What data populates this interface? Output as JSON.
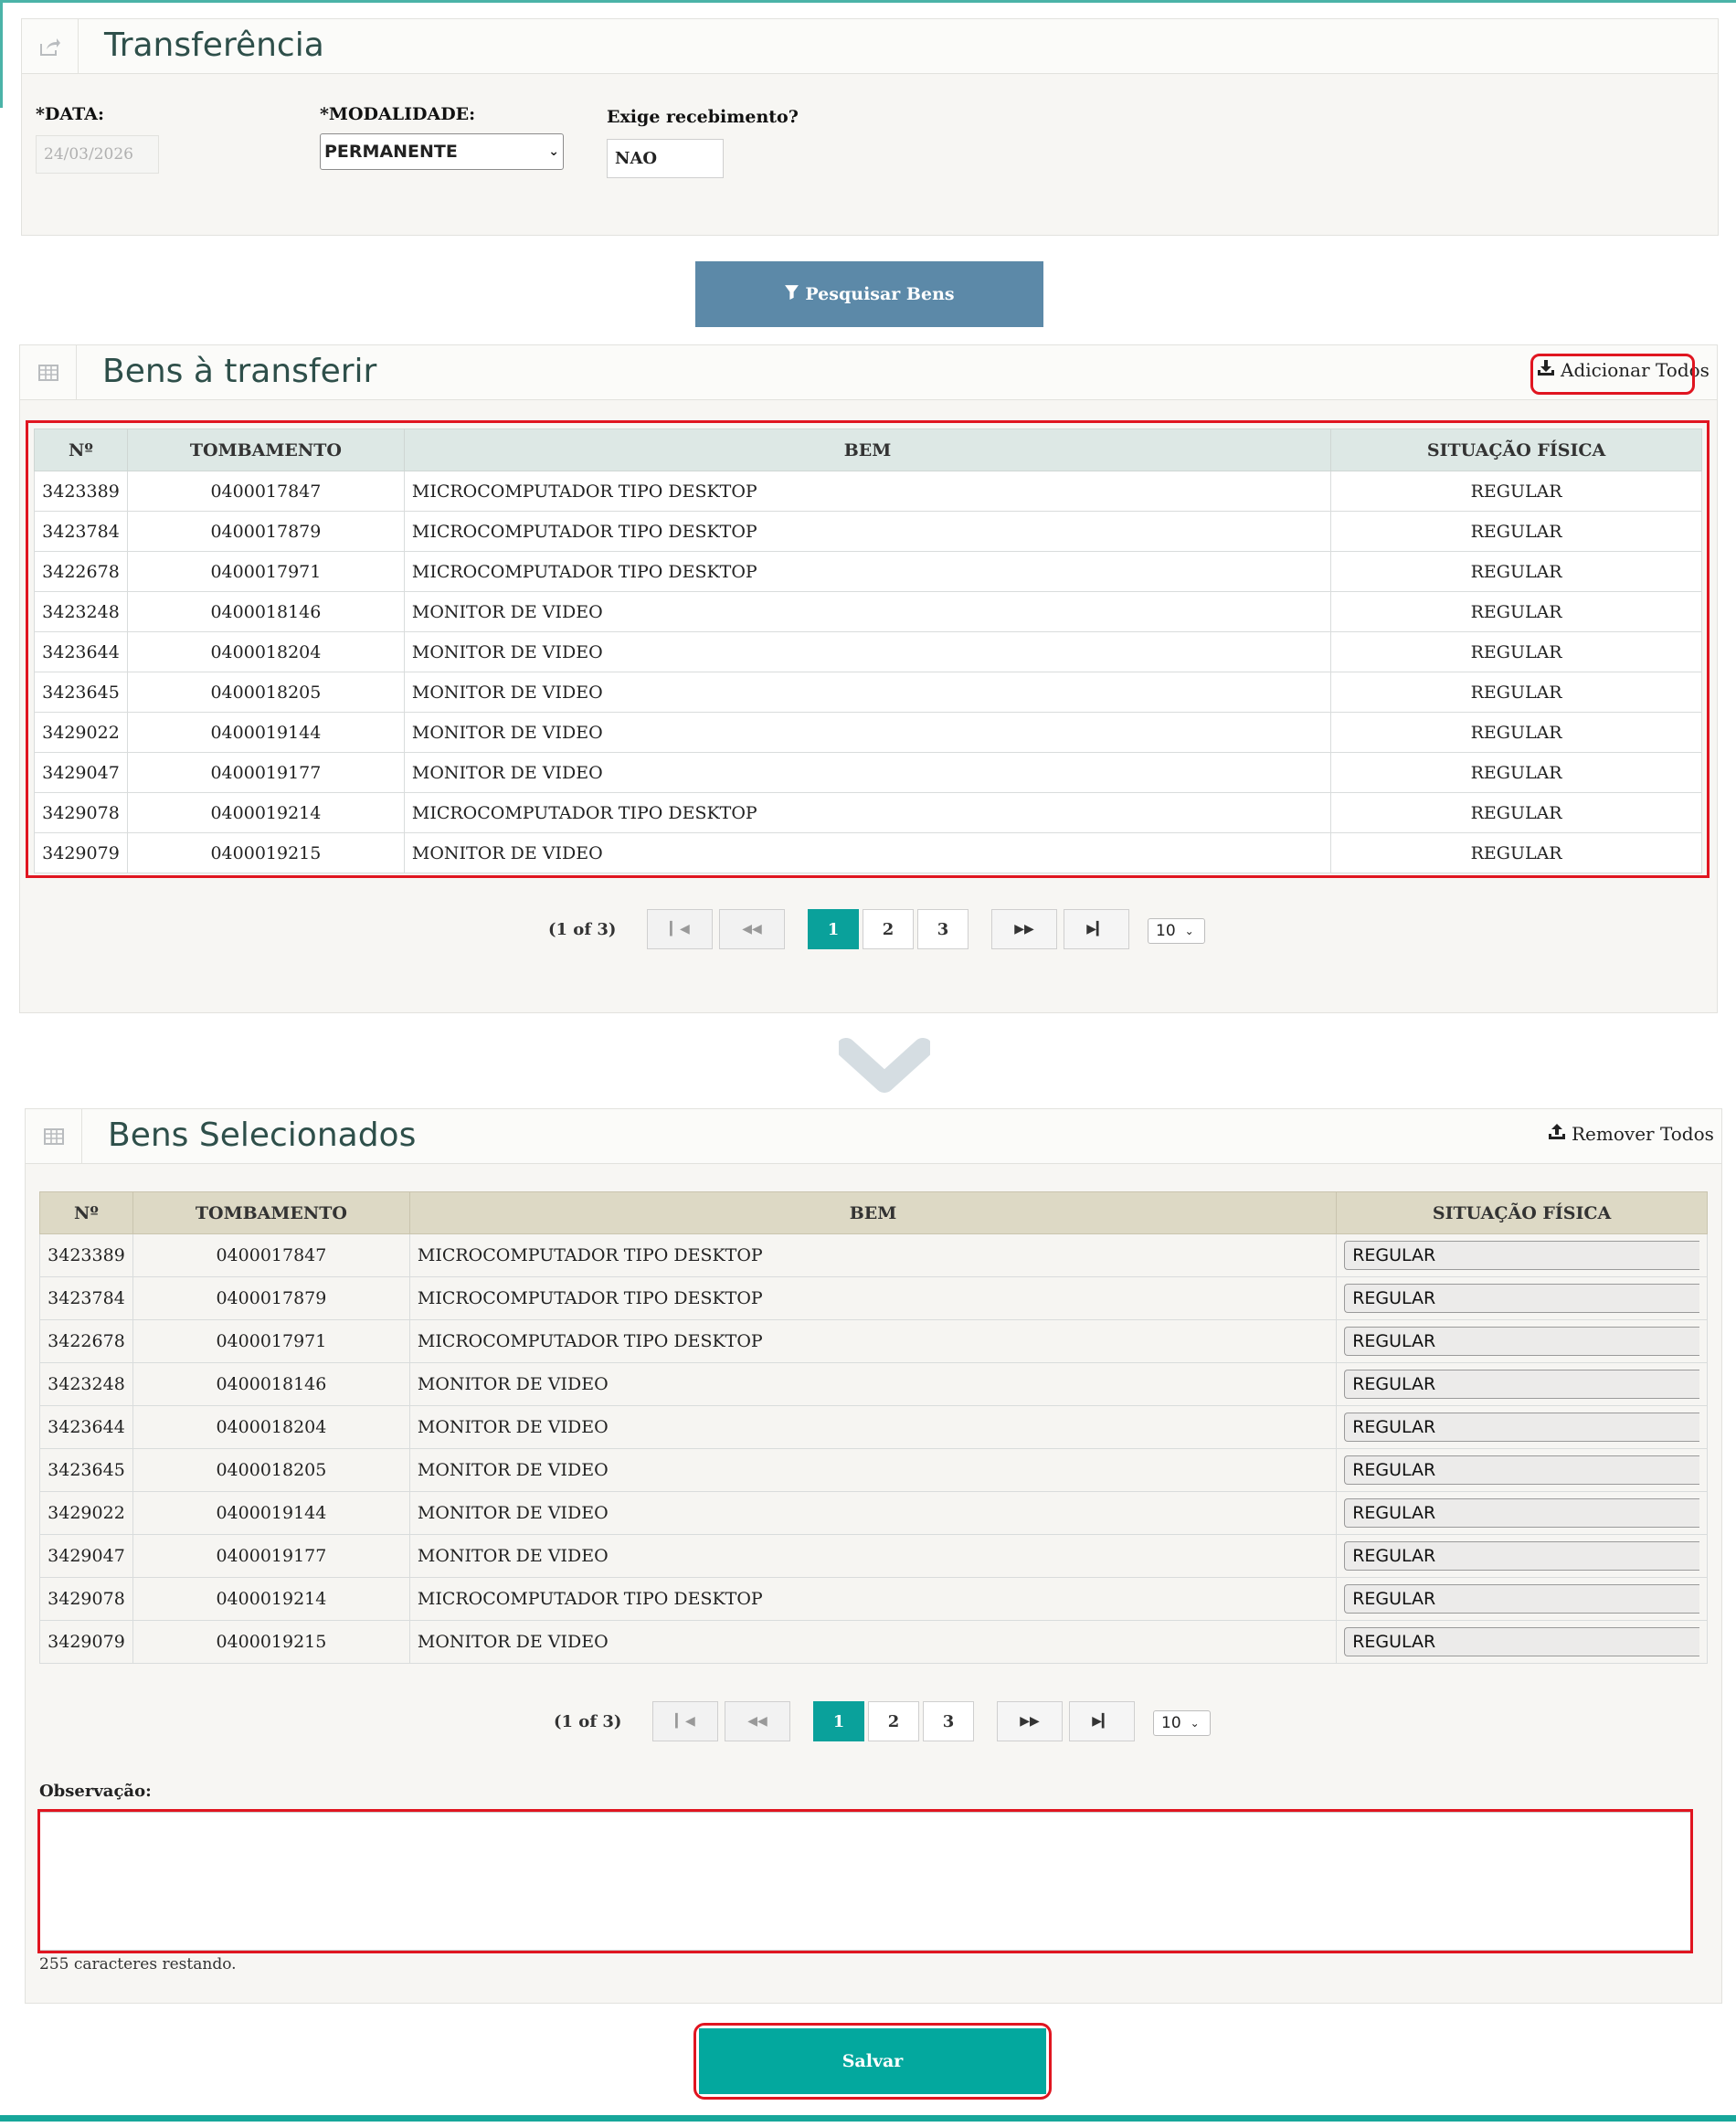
{
  "form": {
    "title": "Transferência",
    "data_label": "*DATA:",
    "data_value": "24/03/2026",
    "modalidade_label": "*MODALIDADE:",
    "modalidade_value": "PERMANENTE",
    "exige_label": "Exige recebimento?",
    "exige_value": "NAO"
  },
  "search_button": "Pesquisar Bens",
  "available": {
    "title": "Bens à transferir",
    "action_label": "Adicionar Todos",
    "columns": [
      "Nº",
      "TOMBAMENTO",
      "BEM",
      "SITUAÇÃO FÍSICA"
    ],
    "rows": [
      [
        "3423389",
        "0400017847",
        "MICROCOMPUTADOR TIPO DESKTOP",
        "REGULAR"
      ],
      [
        "3423784",
        "0400017879",
        "MICROCOMPUTADOR TIPO DESKTOP",
        "REGULAR"
      ],
      [
        "3422678",
        "0400017971",
        "MICROCOMPUTADOR TIPO DESKTOP",
        "REGULAR"
      ],
      [
        "3423248",
        "0400018146",
        "MONITOR DE VIDEO",
        "REGULAR"
      ],
      [
        "3423644",
        "0400018204",
        "MONITOR DE VIDEO",
        "REGULAR"
      ],
      [
        "3423645",
        "0400018205",
        "MONITOR DE VIDEO",
        "REGULAR"
      ],
      [
        "3429022",
        "0400019144",
        "MONITOR DE VIDEO",
        "REGULAR"
      ],
      [
        "3429047",
        "0400019177",
        "MONITOR DE VIDEO",
        "REGULAR"
      ],
      [
        "3429078",
        "0400019214",
        "MICROCOMPUTADOR TIPO DESKTOP",
        "REGULAR"
      ],
      [
        "3429079",
        "0400019215",
        "MONITOR DE VIDEO",
        "REGULAR"
      ]
    ],
    "pager": {
      "info": "(1 of 3)",
      "pages": [
        "1",
        "2",
        "3"
      ],
      "current_page": "1",
      "page_size": "10"
    }
  },
  "selected": {
    "title": "Bens Selecionados",
    "action_label": "Remover Todos",
    "columns": [
      "Nº",
      "TOMBAMENTO",
      "BEM",
      "SITUAÇÃO FÍSICA"
    ],
    "rows": [
      [
        "3423389",
        "0400017847",
        "MICROCOMPUTADOR TIPO DESKTOP",
        "REGULAR"
      ],
      [
        "3423784",
        "0400017879",
        "MICROCOMPUTADOR TIPO DESKTOP",
        "REGULAR"
      ],
      [
        "3422678",
        "0400017971",
        "MICROCOMPUTADOR TIPO DESKTOP",
        "REGULAR"
      ],
      [
        "3423248",
        "0400018146",
        "MONITOR DE VIDEO",
        "REGULAR"
      ],
      [
        "3423644",
        "0400018204",
        "MONITOR DE VIDEO",
        "REGULAR"
      ],
      [
        "3423645",
        "0400018205",
        "MONITOR DE VIDEO",
        "REGULAR"
      ],
      [
        "3429022",
        "0400019144",
        "MONITOR DE VIDEO",
        "REGULAR"
      ],
      [
        "3429047",
        "0400019177",
        "MONITOR DE VIDEO",
        "REGULAR"
      ],
      [
        "3429078",
        "0400019214",
        "MICROCOMPUTADOR TIPO DESKTOP",
        "REGULAR"
      ],
      [
        "3429079",
        "0400019215",
        "MONITOR DE VIDEO",
        "REGULAR"
      ]
    ],
    "pager": {
      "info": "(1 of 3)",
      "pages": [
        "1",
        "2",
        "3"
      ],
      "current_page": "1",
      "page_size": "10"
    }
  },
  "observacao": {
    "label": "Observação:",
    "value": "",
    "remaining": "255 caracteres restando."
  },
  "save_button": "Salvar",
  "colors": {
    "accent_teal": "#03a89e",
    "search_button": "#5c89a8",
    "highlight_red": "#e01520",
    "title_text": "#2e4f4a"
  },
  "icons": {
    "transfer_panel": "share-icon",
    "table_panel": "table-icon",
    "search": "filter-icon",
    "add_all": "download-icon",
    "remove_all": "upload-icon",
    "divider": "chevron-down-icon"
  }
}
